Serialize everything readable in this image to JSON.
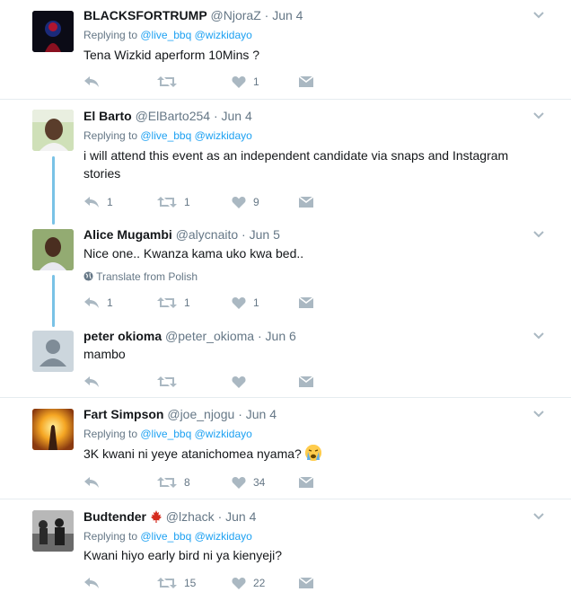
{
  "tweets": [
    {
      "name": "BLACKSFORTRUMP",
      "handle": "@NjoraZ",
      "dot": "·",
      "date": "Jun 4",
      "replying_prefix": "Replying to ",
      "replying_to": "@live_bbq @wizkidayo",
      "text": "Tena Wizkid aperform 10Mins ?",
      "reply_count": "",
      "retweet_count": "",
      "like_count": "1"
    },
    {
      "name": "El Barto",
      "handle": "@ElBarto254",
      "dot": "·",
      "date": "Jun 4",
      "replying_prefix": "Replying to ",
      "replying_to": "@live_bbq @wizkidayo",
      "text": "i will attend this event as an independent candidate via snaps and Instagram stories",
      "reply_count": "1",
      "retweet_count": "1",
      "like_count": "9"
    },
    {
      "name": "Alice Mugambi",
      "handle": "@alycnaito",
      "dot": "·",
      "date": "Jun 5",
      "text": "Nice one.. Kwanza kama uko kwa bed..",
      "translate": "Translate from Polish",
      "reply_count": "1",
      "retweet_count": "1",
      "like_count": "1"
    },
    {
      "name": "peter okioma",
      "handle": "@peter_okioma",
      "dot": "·",
      "date": "Jun 6",
      "text": "mambo",
      "reply_count": "",
      "retweet_count": "",
      "like_count": ""
    },
    {
      "name": "Fart Simpson",
      "handle": "@joe_njogu",
      "dot": "·",
      "date": "Jun 4",
      "replying_prefix": "Replying to ",
      "replying_to": "@live_bbq @wizkidayo",
      "text": "3K kwani ni yeye atanichomea nyama?",
      "emoji": "crying-face-emoji",
      "reply_count": "",
      "retweet_count": "8",
      "like_count": "34"
    },
    {
      "name": "Budtender",
      "flag": "canada-flag-icon",
      "handle": "@lzhack",
      "dot": "·",
      "date": "Jun 4",
      "replying_prefix": "Replying to ",
      "replying_to": "@live_bbq @wizkidayo",
      "text": "Kwani hiyo early bird ni ya kienyeji?",
      "reply_count": "",
      "retweet_count": "15",
      "like_count": "22"
    }
  ],
  "colors": {
    "text": "#14171a",
    "secondary": "#657786",
    "link": "#1da1f2",
    "icon": "#aab8c2",
    "thread_line": "#79c2e6",
    "separator": "#e6ecf0"
  }
}
